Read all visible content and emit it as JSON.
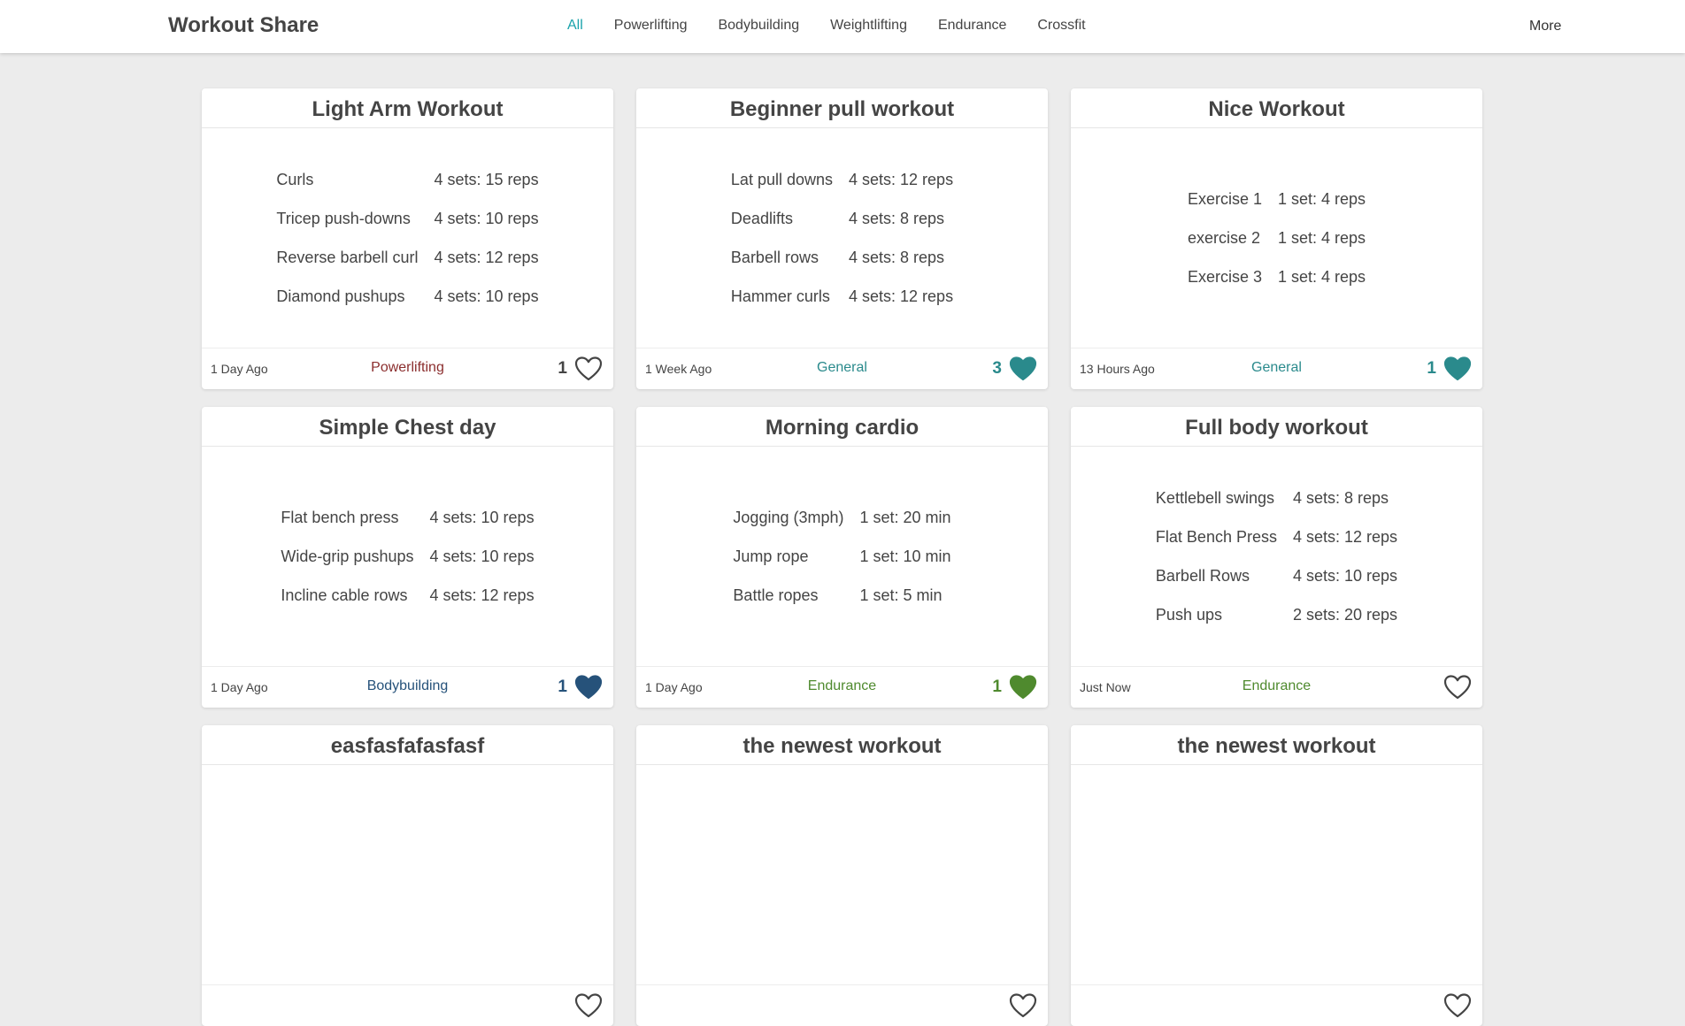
{
  "nav": {
    "brand": "Workout Share",
    "links": [
      "All",
      "Powerlifting",
      "Bodybuilding",
      "Weightlifting",
      "Endurance",
      "Crossfit"
    ],
    "active": "All",
    "more": "More"
  },
  "colors": {
    "accent": "#1aa3ab",
    "powerlifting": "#8b2e2e",
    "general": "#2a8a8c",
    "bodybuilding": "#26527a",
    "endurance": "#4f8a2e",
    "heart_outline": "#444444"
  },
  "cards": [
    {
      "title": "Light Arm Workout",
      "exercises": [
        {
          "name": "Curls",
          "detail": "4 sets: 15 reps"
        },
        {
          "name": "Tricep push-downs",
          "detail": "4 sets: 10 reps"
        },
        {
          "name": "Reverse barbell curl",
          "detail": "4 sets: 12 reps"
        },
        {
          "name": "Diamond pushups",
          "detail": "4 sets: 10 reps"
        }
      ],
      "time": "1 Day Ago",
      "category": "Powerlifting",
      "category_color": "#8b2e2e",
      "likes": "1",
      "liked": false,
      "like_color": "#444444"
    },
    {
      "title": "Beginner pull workout",
      "exercises": [
        {
          "name": "Lat pull downs",
          "detail": "4 sets: 12 reps"
        },
        {
          "name": "Deadlifts",
          "detail": "4 sets: 8 reps"
        },
        {
          "name": "Barbell rows",
          "detail": "4 sets: 8 reps"
        },
        {
          "name": "Hammer curls",
          "detail": "4 sets: 12 reps"
        }
      ],
      "time": "1 Week Ago",
      "category": "General",
      "category_color": "#2a8a8c",
      "likes": "3",
      "liked": true,
      "like_color": "#2a8a8c"
    },
    {
      "title": "Nice Workout",
      "exercises": [
        {
          "name": "Exercise 1",
          "detail": "1 set: 4 reps"
        },
        {
          "name": "exercise 2",
          "detail": "1 set: 4 reps"
        },
        {
          "name": "Exercise 3",
          "detail": "1 set: 4 reps"
        }
      ],
      "time": "13 Hours Ago",
      "category": "General",
      "category_color": "#2a8a8c",
      "likes": "1",
      "liked": true,
      "like_color": "#2a8a8c"
    },
    {
      "title": "Simple Chest day",
      "exercises": [
        {
          "name": "Flat bench press",
          "detail": "4 sets: 10 reps"
        },
        {
          "name": "Wide-grip pushups",
          "detail": "4 sets: 10 reps"
        },
        {
          "name": "Incline cable rows",
          "detail": "4 sets: 12 reps"
        }
      ],
      "time": "1 Day Ago",
      "category": "Bodybuilding",
      "category_color": "#26527a",
      "likes": "1",
      "liked": true,
      "like_color": "#26527a"
    },
    {
      "title": "Morning cardio",
      "exercises": [
        {
          "name": "Jogging (3mph)",
          "detail": "1 set: 20 min"
        },
        {
          "name": "Jump rope",
          "detail": "1 set: 10 min"
        },
        {
          "name": "Battle ropes",
          "detail": "1 set: 5 min"
        }
      ],
      "time": "1 Day Ago",
      "category": "Endurance",
      "category_color": "#4f8a2e",
      "likes": "1",
      "liked": true,
      "like_color": "#4f8a2e"
    },
    {
      "title": "Full body workout",
      "exercises": [
        {
          "name": "Kettlebell swings",
          "detail": "4 sets: 8 reps"
        },
        {
          "name": "Flat Bench Press",
          "detail": "4 sets: 12 reps"
        },
        {
          "name": "Barbell Rows",
          "detail": "4 sets: 10 reps"
        },
        {
          "name": "Push ups",
          "detail": "2 sets: 20 reps"
        }
      ],
      "time": "Just Now",
      "category": "Endurance",
      "category_color": "#4f8a2e",
      "likes": "",
      "liked": false,
      "like_color": "#444444"
    },
    {
      "title": "easfasfafasfasf",
      "exercises": [],
      "time": "",
      "category": "",
      "category_color": "#444444",
      "likes": "",
      "liked": false,
      "like_color": "#444444"
    },
    {
      "title": "the newest workout",
      "exercises": [],
      "time": "",
      "category": "",
      "category_color": "#444444",
      "likes": "",
      "liked": false,
      "like_color": "#444444"
    },
    {
      "title": "the newest workout",
      "exercises": [],
      "time": "",
      "category": "",
      "category_color": "#444444",
      "likes": "",
      "liked": false,
      "like_color": "#444444"
    }
  ]
}
